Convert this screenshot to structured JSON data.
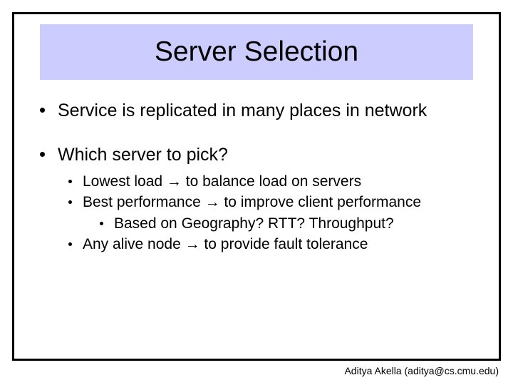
{
  "title": "Server Selection",
  "bullets": {
    "b1": "Service is replicated in many places in network",
    "b2": "Which server to pick?",
    "sub": {
      "s1": "Lowest load → to balance load on servers",
      "s2": "Best performance → to improve client performance",
      "s2a": "Based on Geography? RTT? Throughput?",
      "s3": "Any alive node → to provide fault tolerance"
    }
  },
  "footer": "Aditya Akella (aditya@cs.cmu.edu)"
}
